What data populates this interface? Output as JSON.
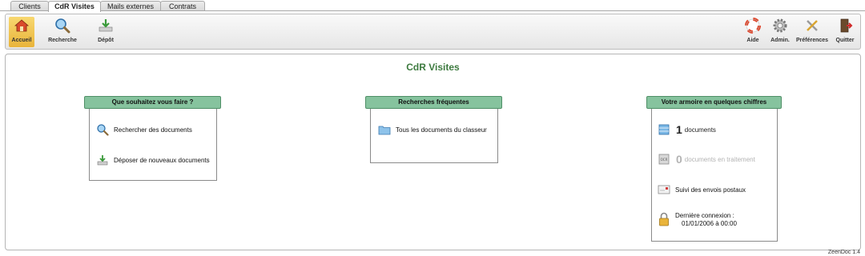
{
  "tabs": [
    {
      "label": "Clients"
    },
    {
      "label": "CdR Visites"
    },
    {
      "label": "Mails externes"
    },
    {
      "label": "Contrats"
    }
  ],
  "toolbar": {
    "left": [
      {
        "label": "Accueil",
        "icon": "home-icon"
      },
      {
        "label": "Recherche",
        "icon": "search-icon"
      },
      {
        "label": "Dépôt",
        "icon": "upload-icon"
      }
    ],
    "right": [
      {
        "label": "Aide",
        "icon": "lifebuoy-icon"
      },
      {
        "label": "Admin.",
        "icon": "gear-icon"
      },
      {
        "label": "Préférences",
        "icon": "tools-icon"
      },
      {
        "label": "Quitter",
        "icon": "exit-icon"
      }
    ]
  },
  "main": {
    "title": "CdR Visites",
    "actions": {
      "header": "Que souhaitez vous faire ?",
      "items": [
        "Rechercher des documents",
        "Déposer de nouveaux documents"
      ]
    },
    "frequent": {
      "header": "Recherches fréquentes",
      "items": [
        "Tous les documents du classeur"
      ]
    },
    "stats": {
      "header": "Votre armoire en quelques chiffres",
      "documents_count": "1",
      "documents_label": "documents",
      "processing_count": "0",
      "processing_label": "documents en traitement",
      "mail_label": "Suivi des envois postaux",
      "last_login_label": "Dernière connexion :",
      "last_login_value": "01/01/2006 à 00:00"
    }
  },
  "footer": {
    "version": "ZeenDoc 1.4"
  },
  "colors": {
    "accent": "#86c39e",
    "title": "#3d7a3f",
    "active_tool": "#e9b43a"
  }
}
